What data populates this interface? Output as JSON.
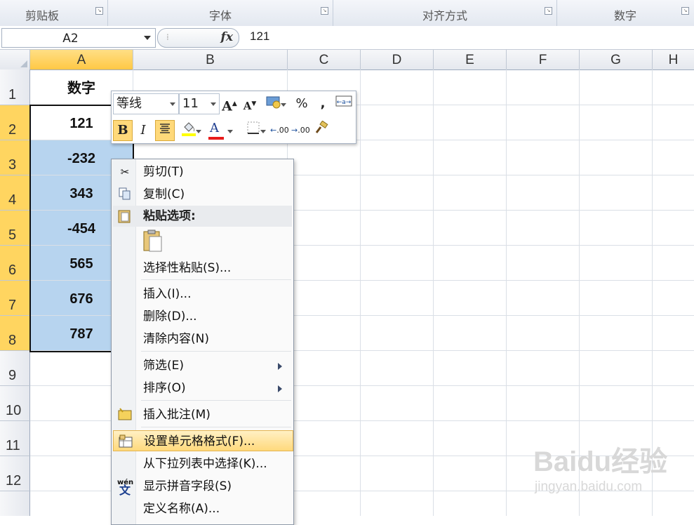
{
  "ribbon": {
    "groups": [
      "剪贴板",
      "字体",
      "对齐方式",
      "数字"
    ]
  },
  "formula_bar": {
    "name_box": "A2",
    "fx_label": "fx",
    "formula": "121"
  },
  "columns": [
    "A",
    "B",
    "C",
    "D",
    "E",
    "F",
    "G",
    "H"
  ],
  "rows": [
    "1",
    "2",
    "3",
    "4",
    "5",
    "6",
    "7",
    "8",
    "9",
    "10",
    "11",
    "12"
  ],
  "cells": {
    "a1": "数字",
    "a2": "121",
    "a3": "-232",
    "a4": "343",
    "a5": "-454",
    "a6": "565",
    "a7": "676",
    "a8": "787"
  },
  "mini_toolbar": {
    "font": "等线",
    "size": "11",
    "percent": "%",
    "comma": ",",
    "bold": "B",
    "italic": "I",
    "font_color_letter": "A",
    "grow_letter": "A",
    "shrink_letter": "A",
    "inc_decimal": ".00",
    "dec_decimal": ".00"
  },
  "context_menu": {
    "items": {
      "cut": "剪切(T)",
      "copy": "复制(C)",
      "paste_options": "粘贴选项:",
      "paste_special": "选择性粘贴(S)...",
      "insert": "插入(I)...",
      "delete": "删除(D)...",
      "clear": "清除内容(N)",
      "filter": "筛选(E)",
      "sort": "排序(O)",
      "insert_comment": "插入批注(M)",
      "format_cells": "设置单元格格式(F)...",
      "pick_list": "从下拉列表中选择(K)...",
      "phonetic": "显示拼音字段(S)",
      "define_name": "定义名称(A)..."
    },
    "phonetic_icon_text": "wén"
  },
  "watermark": {
    "logo": "Baidu经验",
    "url": "jingyan.baidu.com"
  },
  "colors": {
    "selection_fill": "#b7d4ef",
    "header_highlight": "#ffd560",
    "menu_hover": "#ffd97c",
    "font_color_bar": "#e81b1b",
    "highlight_bar": "#ffff00"
  }
}
